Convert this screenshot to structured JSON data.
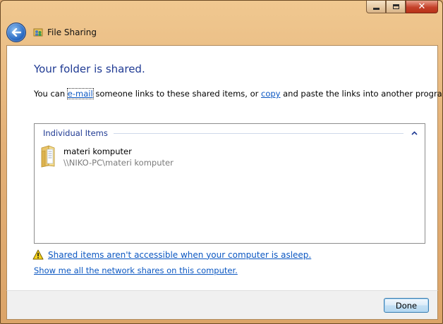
{
  "window": {
    "title": "File Sharing",
    "caption_buttons": {
      "minimize_icon": "minimize-icon",
      "maximize_icon": "maximize-icon",
      "close_icon": "close-icon"
    }
  },
  "content": {
    "heading": "Your folder is shared.",
    "intro": {
      "prefix": "You can ",
      "email_link": "e-mail",
      "middle": " someone links to these shared items, or ",
      "copy_link": "copy",
      "suffix": " and paste the links into another program."
    },
    "items_group": {
      "title": "Individual Items",
      "items": [
        {
          "name": "materi komputer",
          "path": "\\\\NIKO-PC\\materi komputer",
          "icon": "folder-icon"
        }
      ]
    },
    "warning_link": "Shared items aren't accessible when your computer is asleep.",
    "shares_link": "Show me all the network shares on this computer."
  },
  "footer": {
    "done_label": "Done"
  },
  "colors": {
    "heading": "#1f3a93",
    "link": "#0b57c2",
    "frame": "#e3b077"
  }
}
